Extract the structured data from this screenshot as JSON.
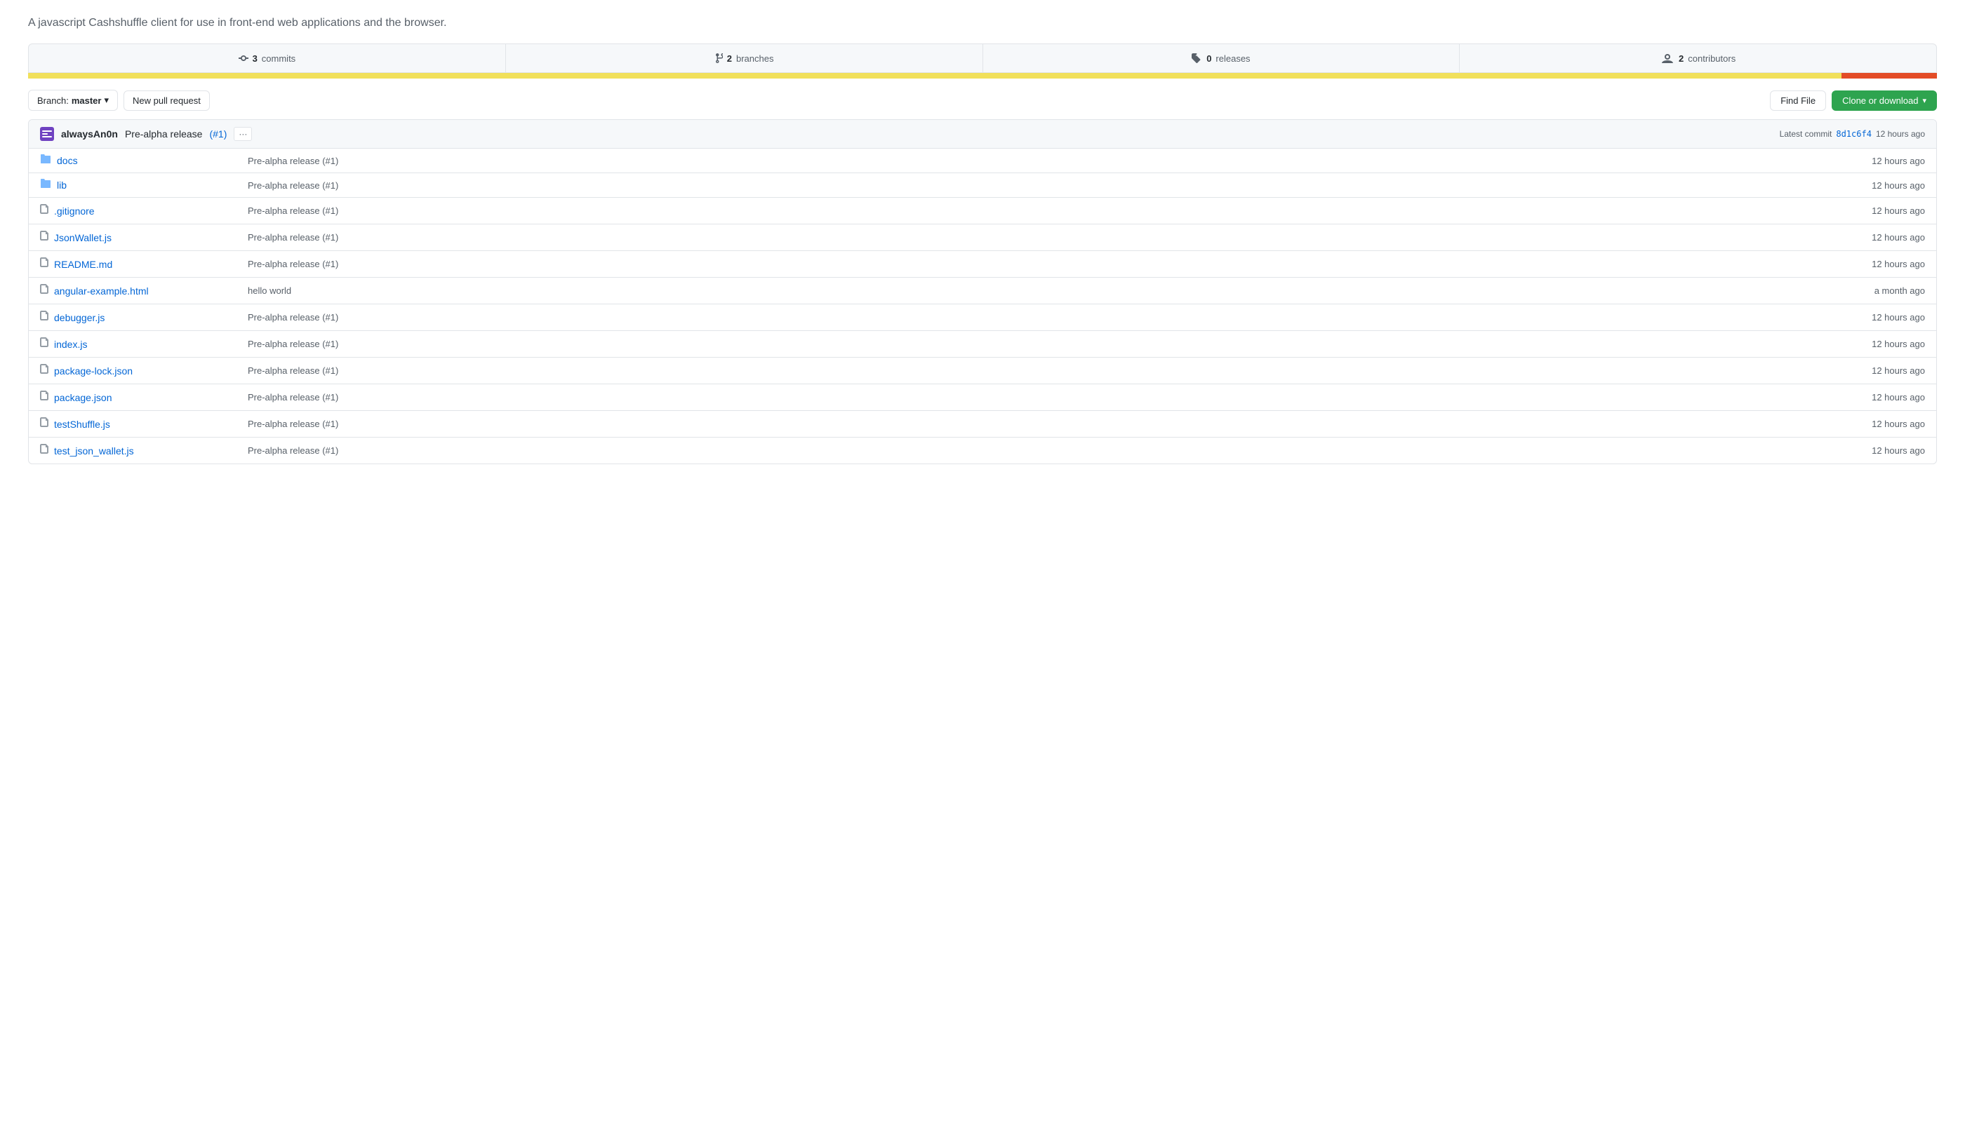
{
  "description": "A javascript Cashshuffle client for use in front-end web applications and the browser.",
  "stats": {
    "commits": {
      "count": "3",
      "label": "commits",
      "icon": "⟳"
    },
    "branches": {
      "count": "2",
      "label": "branches",
      "icon": "⎇"
    },
    "releases": {
      "count": "0",
      "label": "releases",
      "icon": "🏷"
    },
    "contributors": {
      "count": "2",
      "label": "contributors",
      "icon": "👥"
    }
  },
  "toolbar": {
    "branch_label": "Branch:",
    "branch_name": "master",
    "new_pr_label": "New pull request",
    "find_file_label": "Find File",
    "clone_label": "Clone or download"
  },
  "commit_header": {
    "user": "alwaysAn0n",
    "message": "Pre-alpha release",
    "pr_link": "(#1)",
    "more_label": "···",
    "latest_commit_label": "Latest commit",
    "sha": "8d1c6f4",
    "time": "12 hours ago"
  },
  "files": [
    {
      "type": "folder",
      "name": "docs",
      "commit": "Pre-alpha release (#1)",
      "time": "12 hours ago"
    },
    {
      "type": "folder",
      "name": "lib",
      "commit": "Pre-alpha release (#1)",
      "time": "12 hours ago"
    },
    {
      "type": "file",
      "name": ".gitignore",
      "commit": "Pre-alpha release (#1)",
      "time": "12 hours ago"
    },
    {
      "type": "file",
      "name": "JsonWallet.js",
      "commit": "Pre-alpha release (#1)",
      "time": "12 hours ago"
    },
    {
      "type": "file",
      "name": "README.md",
      "commit": "Pre-alpha release (#1)",
      "time": "12 hours ago"
    },
    {
      "type": "file",
      "name": "angular-example.html",
      "commit": "hello world",
      "time": "a month ago"
    },
    {
      "type": "file",
      "name": "debugger.js",
      "commit": "Pre-alpha release (#1)",
      "time": "12 hours ago"
    },
    {
      "type": "file",
      "name": "index.js",
      "commit": "Pre-alpha release (#1)",
      "time": "12 hours ago"
    },
    {
      "type": "file",
      "name": "package-lock.json",
      "commit": "Pre-alpha release (#1)",
      "time": "12 hours ago"
    },
    {
      "type": "file",
      "name": "package.json",
      "commit": "Pre-alpha release (#1)",
      "time": "12 hours ago"
    },
    {
      "type": "file",
      "name": "testShuffle.js",
      "commit": "Pre-alpha release (#1)",
      "time": "12 hours ago"
    },
    {
      "type": "file",
      "name": "test_json_wallet.js",
      "commit": "Pre-alpha release (#1)",
      "time": "12 hours ago"
    }
  ]
}
